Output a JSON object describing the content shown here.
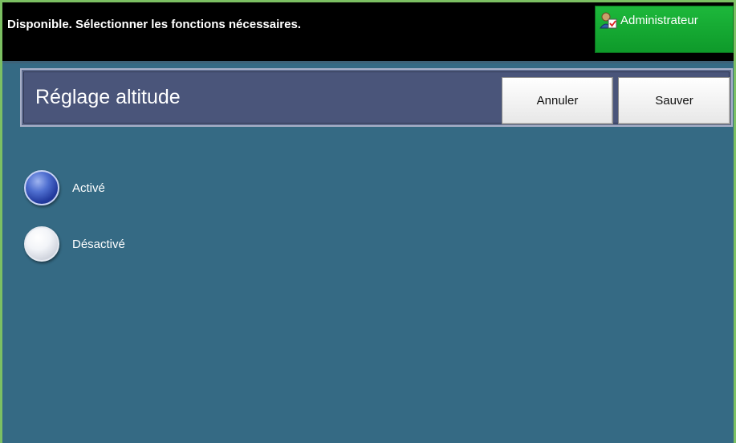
{
  "status_bar": {
    "message": "Disponible.  Sélectionner les fonctions nécessaires.",
    "admin_label": "Administrateur",
    "admin_icon": "administrator-user-icon"
  },
  "header": {
    "title": "Réglage altitude",
    "cancel_label": "Annuler",
    "save_label": "Sauver"
  },
  "options": [
    {
      "label": "Activé",
      "selected": true
    },
    {
      "label": "Désactivé",
      "selected": false
    }
  ],
  "colors": {
    "background": "#356a84",
    "admin_button": "#18a832",
    "title_panel": "#4a557a",
    "selected_radio": "#2c48b0"
  }
}
